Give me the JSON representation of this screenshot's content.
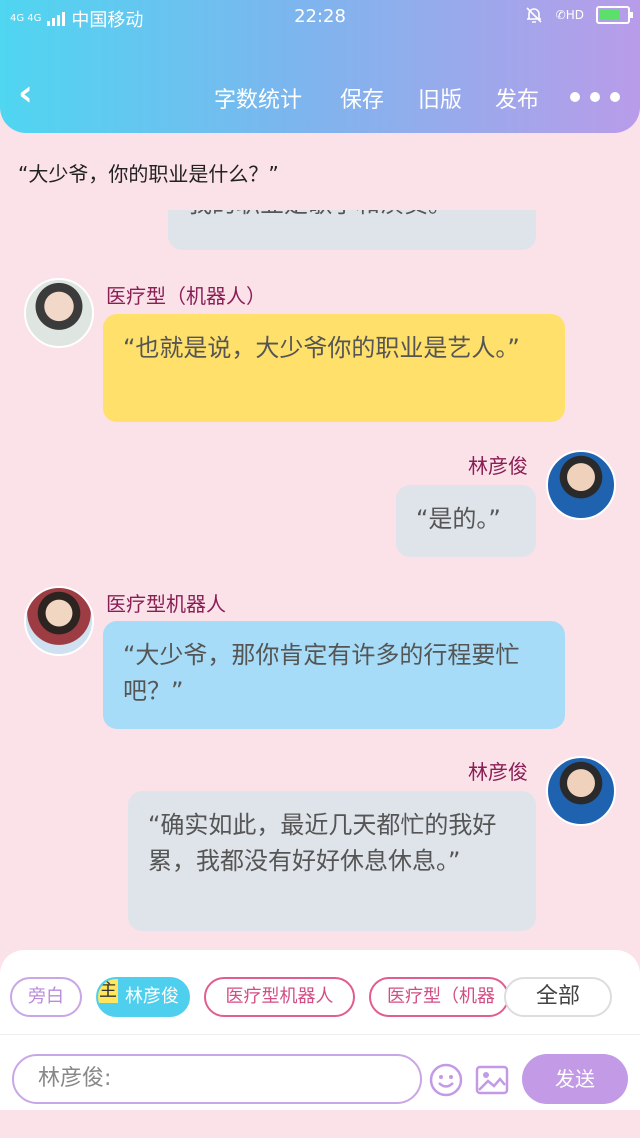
{
  "status": {
    "carrier": "中国移动",
    "network": "4G 4G",
    "time": "22:28",
    "hd": "HD"
  },
  "nav": {
    "items": [
      "字数统计",
      "保存",
      "旧版",
      "发布"
    ]
  },
  "quote": "“大少爷，你的职业是什么？”",
  "messages": [
    {
      "side": "right",
      "text": "我的职业是歌手和演员。"
    },
    {
      "side": "left",
      "name": "医疗型（机器人）",
      "text": "“也就是说，大少爷你的职业是艺人。”"
    },
    {
      "side": "right",
      "name": "林彦俊",
      "text": "“是的。”"
    },
    {
      "side": "left",
      "name": "医疗型机器人",
      "text": "“大少爷，那你肯定有许多的行程要忙吧？”"
    },
    {
      "side": "right",
      "name": "林彦俊",
      "text": "“确实如此，最近几天都忙的我好累，我都没有好好休息休息。”"
    }
  ],
  "roles": {
    "narration": "旁白",
    "main_tag": "主",
    "main": "林彦俊",
    "medical_robot": "医疗型机器人",
    "medical_robot2": "医疗型（机器",
    "all": "全部"
  },
  "composer": {
    "placeholder": "林彦俊:",
    "send": "发送"
  },
  "colors": {
    "accent": "#c39ae6",
    "name": "#8a1e55",
    "bg": "#fbe1e8"
  }
}
